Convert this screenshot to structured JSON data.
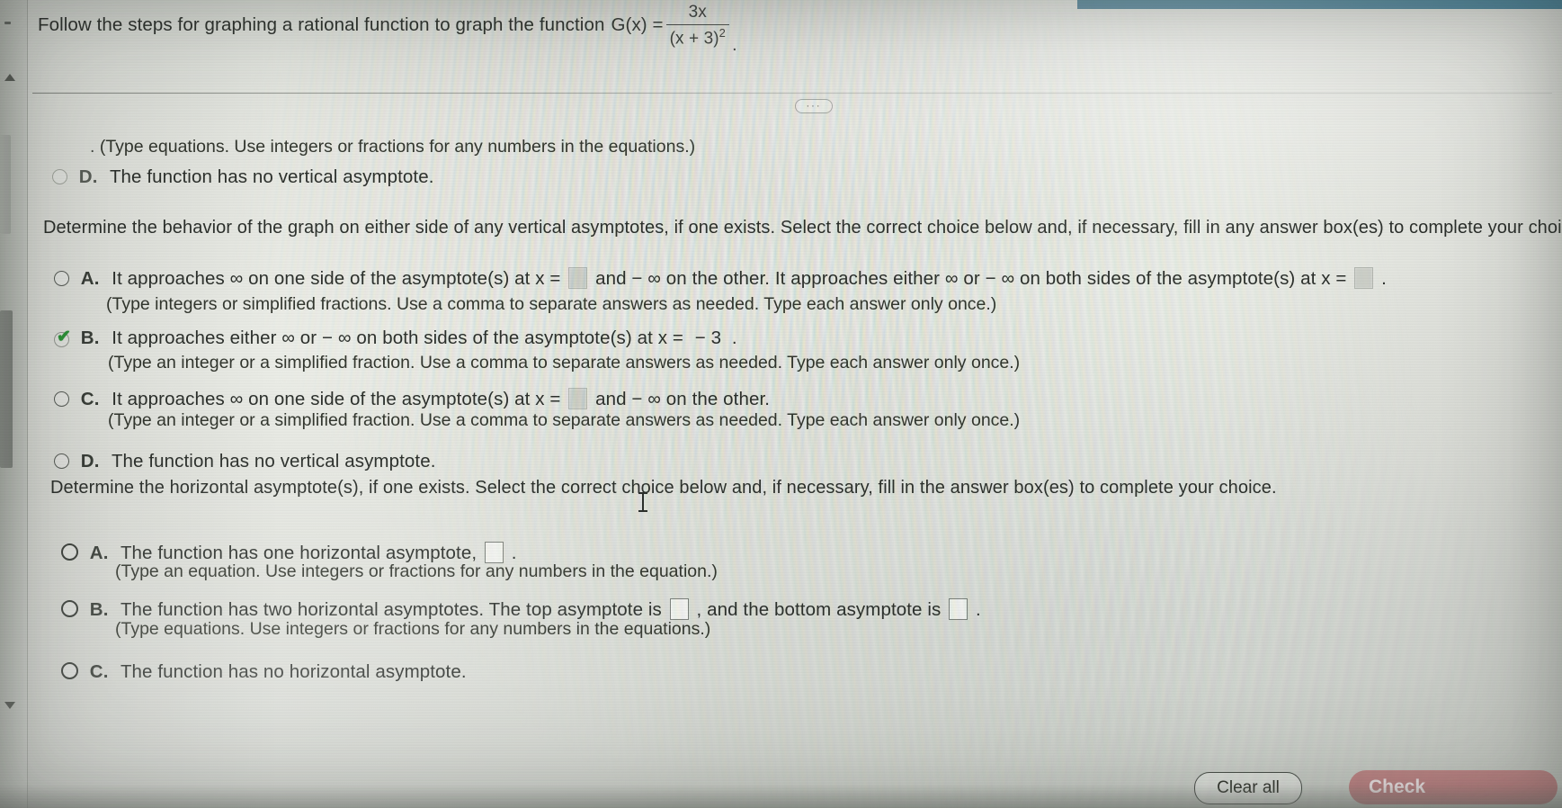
{
  "window": {
    "app": "online math homework",
    "topbar_color": "#31708a"
  },
  "question": {
    "prompt_prefix": "Follow the steps for graphing a rational function to graph the function",
    "function_name": "G(x) =",
    "numerator": "3x",
    "denominator": "(x + 3)",
    "denominator_exponent": "2",
    "trailing_period": "."
  },
  "toolbar": {
    "more_options": "···"
  },
  "vertical_asymptote_tail": {
    "hint": "(Type equations. Use integers or fractions for any numbers in the equations.)",
    "option_d_letter": "D.",
    "option_d_text": "The function has no vertical asymptote."
  },
  "behavior_section": {
    "instruction": "Determine the behavior of the graph on either side of any vertical asymptotes, if one exists. Select the correct choice below and, if necessary, fill in any answer box(es) to complete your choice.",
    "options": [
      {
        "letter": "A.",
        "selected": false,
        "text_part1": "It approaches ∞ on one side of the asymptote(s) at x =",
        "text_part2": "and − ∞ on the other. It approaches either ∞ or − ∞ on both sides of the asymptote(s) at x =",
        "text_part3": ".",
        "hint": "(Type integers or simplified fractions. Use a comma to separate answers as needed. Type each answer only once.)"
      },
      {
        "letter": "B.",
        "selected": true,
        "text_part1": "It approaches either ∞ or − ∞ on both sides of the asymptote(s) at x =",
        "answer_value": "− 3",
        "text_part3": ".",
        "hint": "(Type an integer or a simplified fraction. Use a comma to separate answers as needed. Type each answer only once.)"
      },
      {
        "letter": "C.",
        "selected": false,
        "text_part1": "It approaches ∞ on one side of the asymptote(s) at x =",
        "text_part2": "and − ∞ on the other.",
        "hint": "(Type an integer or a simplified fraction. Use a comma to separate answers as needed. Type each answer only once.)"
      },
      {
        "letter": "D.",
        "selected": false,
        "text_part1": "The function has no vertical asymptote."
      }
    ]
  },
  "horizontal_section": {
    "instruction": "Determine the horizontal asymptote(s), if one exists. Select the correct choice below and, if necessary, fill in the answer box(es) to complete your choice.",
    "options": [
      {
        "letter": "A.",
        "selected": false,
        "text_part1": "The function has one horizontal asymptote,",
        "text_part2": ".",
        "hint": "(Type an equation. Use integers or fractions for any numbers in the equation.)"
      },
      {
        "letter": "B.",
        "selected": false,
        "text_part1": "The function has two horizontal asymptotes. The top asymptote is",
        "text_part2": ", and the bottom asymptote is",
        "text_part3": ".",
        "hint": "(Type equations. Use integers or fractions for any numbers in the equations.)"
      },
      {
        "letter": "C.",
        "selected": false,
        "text_part1": "The function has no horizontal asymptote."
      }
    ]
  },
  "footer": {
    "clear_all": "Clear all",
    "check": "Check",
    "check_color": "#b97f80"
  }
}
